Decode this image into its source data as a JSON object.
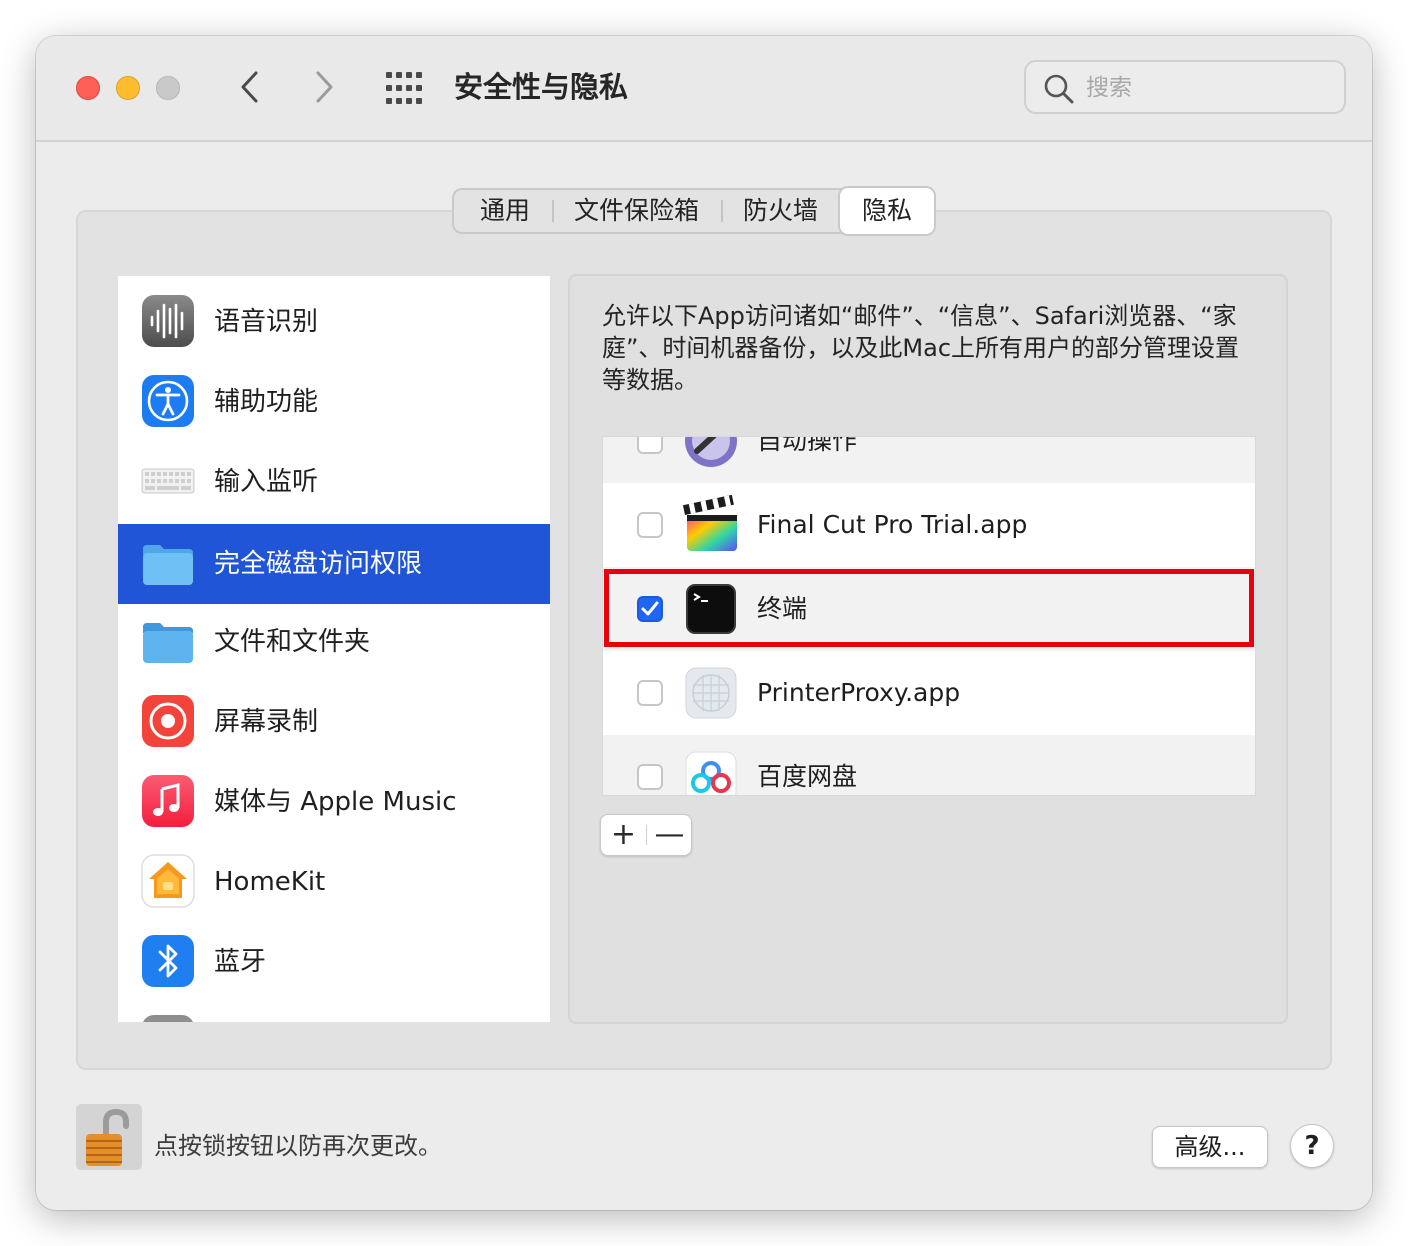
{
  "window": {
    "title": "安全性与隐私",
    "search_placeholder": "搜索"
  },
  "tabs": [
    {
      "label": "通用",
      "active": false
    },
    {
      "label": "文件保险箱",
      "active": false
    },
    {
      "label": "防火墙",
      "active": false
    },
    {
      "label": "隐私",
      "active": true
    }
  ],
  "sidebar": {
    "items": [
      {
        "label": "语音识别",
        "icon": "speech-recognition-icon"
      },
      {
        "label": "辅助功能",
        "icon": "accessibility-icon"
      },
      {
        "label": "输入监听",
        "icon": "keyboard-icon"
      },
      {
        "label": "完全磁盘访问权限",
        "icon": "folder-icon",
        "selected": true
      },
      {
        "label": "文件和文件夹",
        "icon": "folder-icon"
      },
      {
        "label": "屏幕录制",
        "icon": "screen-recording-icon"
      },
      {
        "label": "媒体与 Apple Music",
        "icon": "music-icon"
      },
      {
        "label": "HomeKit",
        "icon": "home-icon"
      },
      {
        "label": "蓝牙",
        "icon": "bluetooth-icon"
      }
    ]
  },
  "description": "允许以下App访问诸如“邮件”、“信息”、Safari浏览器、“家庭”、时间机器备份，以及此Mac上所有用户的部分管理设置等数据。",
  "apps": [
    {
      "label": "自动操作",
      "checked": false,
      "icon": "automator-icon"
    },
    {
      "label": "Final Cut Pro Trial.app",
      "checked": false,
      "icon": "final-cut-pro-icon"
    },
    {
      "label": "终端",
      "checked": true,
      "icon": "terminal-icon"
    },
    {
      "label": "PrinterProxy.app",
      "checked": false,
      "icon": "printer-proxy-icon"
    },
    {
      "label": "百度网盘",
      "checked": false,
      "icon": "baidu-netdisk-icon"
    }
  ],
  "list_buttons": {
    "add": "+",
    "remove": "—"
  },
  "footer": {
    "lock_text": "点按锁按钮以防再次更改。",
    "advanced_label": "高级...",
    "help_label": "?"
  },
  "colors": {
    "selection": "#1f55d6",
    "highlight_border": "#e8000c",
    "checkbox_checked": "#2166f2"
  }
}
